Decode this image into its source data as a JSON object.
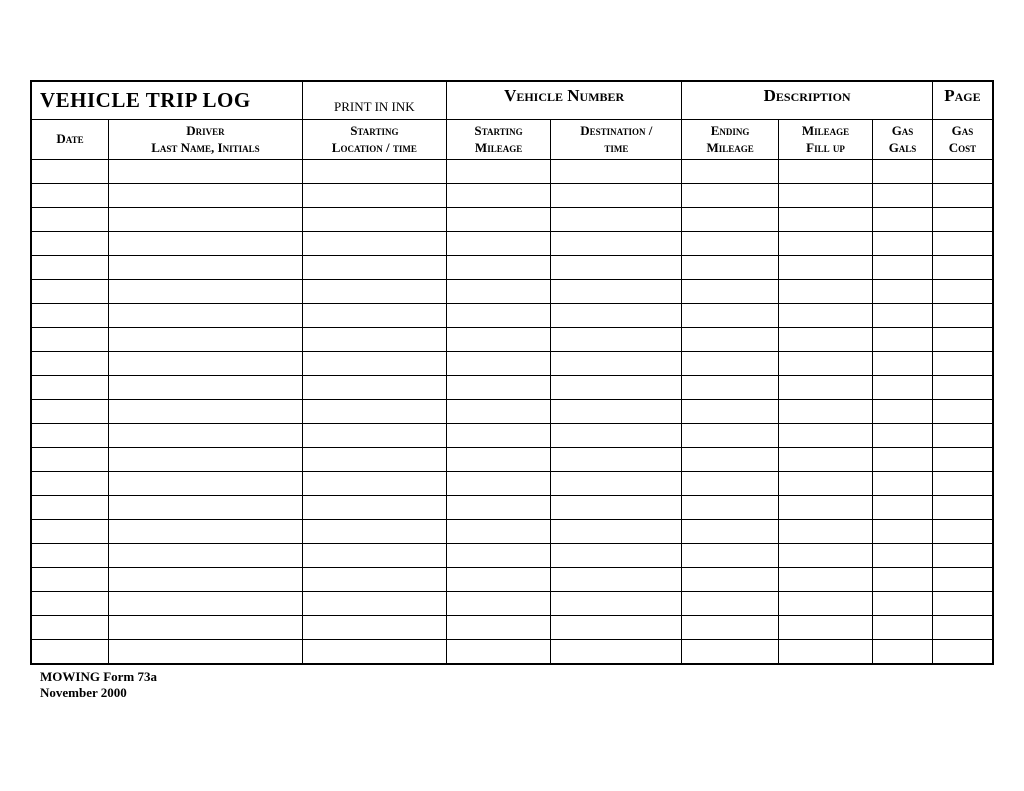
{
  "header": {
    "title": "VEHICLE TRIP LOG",
    "print_in_ink": "PRINT IN INK",
    "vehicle_number": "Vehicle Number",
    "description": "Description",
    "page": "Page"
  },
  "columns": {
    "date": "Date",
    "driver": "Driver\nLast Name, Initials",
    "start_loc": "Starting\nLocation / time",
    "start_mileage": "Starting\nMileage",
    "destination": "Destination /\ntime",
    "end_mileage": "Ending\nMileage",
    "mileage_fillup": "Mileage\nFill up",
    "gas_gals": "Gas\nGals",
    "gas_cost": "Gas\nCost"
  },
  "rows": 21,
  "footer": {
    "form": "MOWING Form 73a",
    "date": "November 2000"
  }
}
